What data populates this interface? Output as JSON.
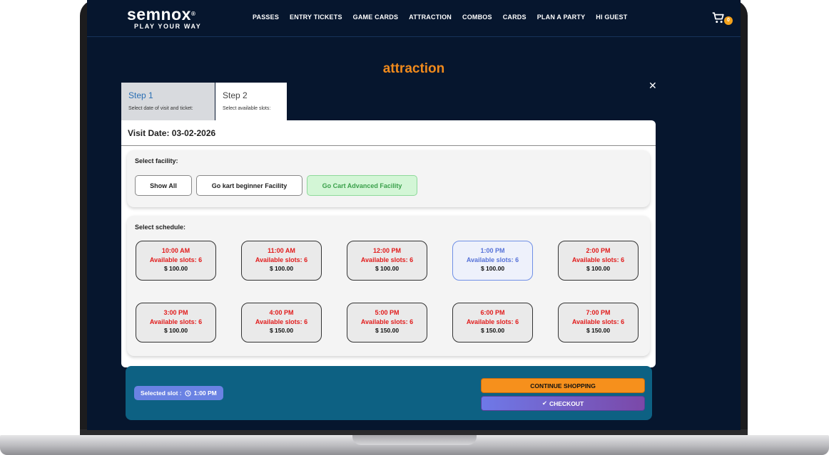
{
  "brand": {
    "name": "semnox",
    "registered": "®",
    "tagline": "PLAY YOUR WAY"
  },
  "nav": {
    "links": [
      "PASSES",
      "ENTRY TICKETS",
      "GAME CARDS",
      "ATTRACTION",
      "COMBOS",
      "CARDS",
      "PLAN A PARTY",
      "HI GUEST"
    ],
    "cart_icon": "shopping-cart-icon",
    "cart_count": "0"
  },
  "page": {
    "title": "attraction",
    "close_symbol": "✕"
  },
  "steps": [
    {
      "title": "Step 1",
      "subtitle": "Select date of visit and ticket:"
    },
    {
      "title": "Step 2",
      "subtitle": "Select available slots:"
    }
  ],
  "visit": {
    "date_label": "Visit Date: 03-02-2026"
  },
  "facility": {
    "label": "Select facility:",
    "options": [
      "Show All",
      "Go kart beginner Facility",
      "Go Cart Advanced Facility"
    ],
    "active": "Go Cart Advanced Facility"
  },
  "schedule": {
    "label": "Select schedule:",
    "slots": [
      {
        "time": "10:00 AM",
        "availability": "Available slots: 6",
        "price": "$ 100.00"
      },
      {
        "time": "11:00 AM",
        "availability": "Available slots: 6",
        "price": "$ 100.00"
      },
      {
        "time": "12:00 PM",
        "availability": "Available slots: 6",
        "price": "$ 100.00"
      },
      {
        "time": "1:00 PM",
        "availability": "Available slots: 6",
        "price": "$ 100.00"
      },
      {
        "time": "2:00 PM",
        "availability": "Available slots: 6",
        "price": "$ 100.00"
      },
      {
        "time": "3:00 PM",
        "availability": "Available slots: 6",
        "price": "$ 100.00"
      },
      {
        "time": "4:00 PM",
        "availability": "Available slots: 6",
        "price": "$ 150.00"
      },
      {
        "time": "5:00 PM",
        "availability": "Available slots: 6",
        "price": "$ 150.00"
      },
      {
        "time": "6:00 PM",
        "availability": "Available slots: 6",
        "price": "$ 150.00"
      },
      {
        "time": "7:00 PM",
        "availability": "Available slots: 6",
        "price": "$ 150.00"
      }
    ],
    "selected_time": "1:00 PM"
  },
  "footer": {
    "selected_label": "Selected slot :",
    "clock_icon": "clock-icon",
    "selected_time": "1:00 PM",
    "continue_label": "CONTINUE SHOPPING",
    "checkout_check": "✔",
    "checkout_label": "CHECKOUT"
  },
  "colors": {
    "screen_bg": "#06162e",
    "accent_orange": "#f08a1c",
    "slot_text_red": "#e11b1b",
    "selected_blue": "#5672d8",
    "bottom_bar": "#0d6183",
    "facility_active_green": "#3aa04a"
  }
}
